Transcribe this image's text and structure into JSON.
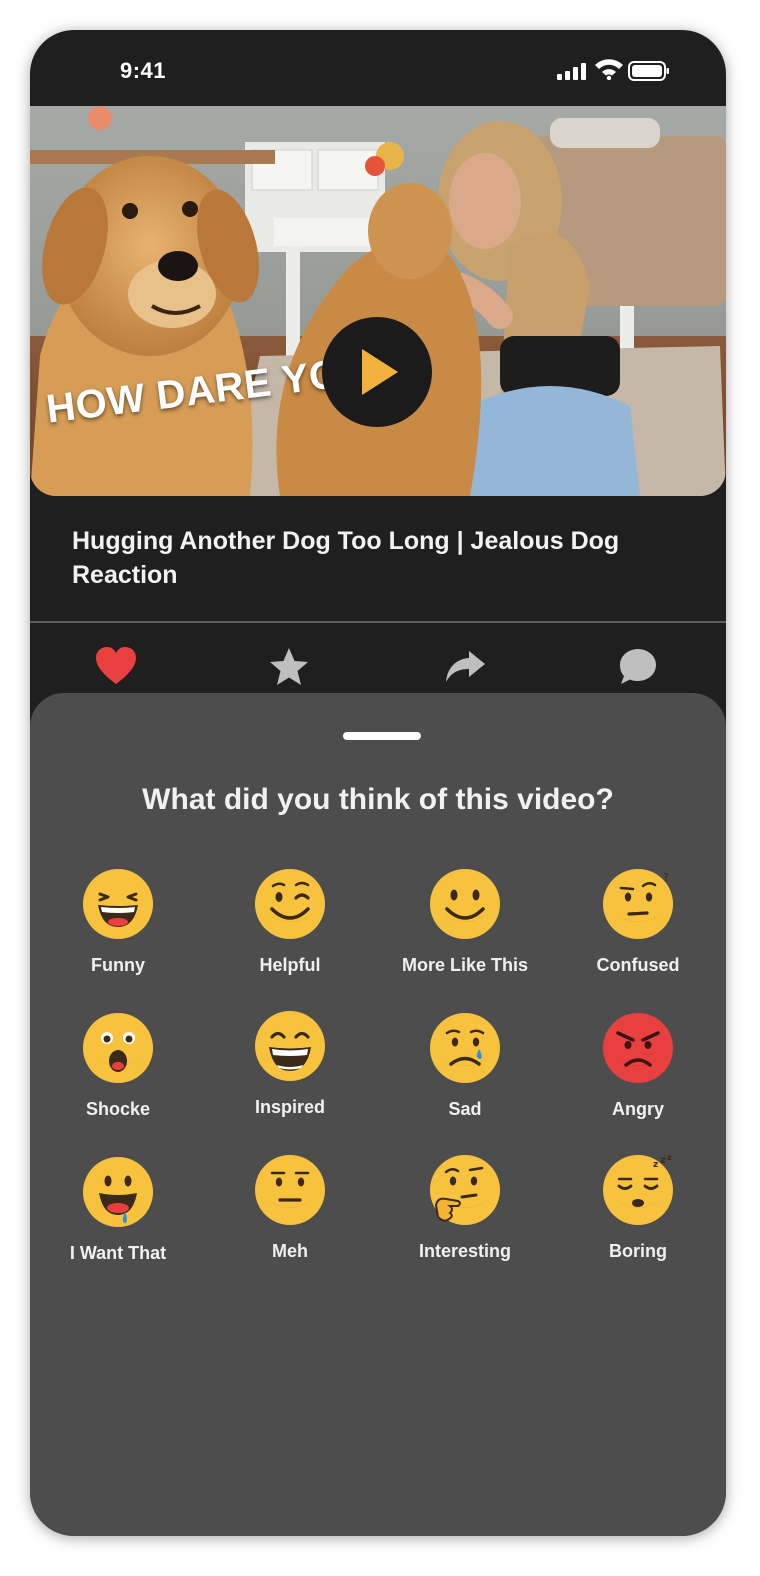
{
  "status_bar": {
    "time": "9:41"
  },
  "video": {
    "overlay_text": "HOW DARE YOU",
    "title": "Hugging Another Dog Too Long | Jealous Dog Reaction"
  },
  "actions": [
    {
      "icon": "heart-icon",
      "color": "#e8403f"
    },
    {
      "icon": "star-icon",
      "color": "#bfbfbf"
    },
    {
      "icon": "share-icon",
      "color": "#bfbfbf"
    },
    {
      "icon": "comment-icon",
      "color": "#bfbfbf"
    }
  ],
  "sheet": {
    "title": "What did you think of this video?",
    "reactions": [
      {
        "label": "Funny",
        "icon": "laughing-face-icon"
      },
      {
        "label": "Helpful",
        "icon": "winking-face-icon"
      },
      {
        "label": "More Like This",
        "icon": "smiling-face-icon"
      },
      {
        "label": "Confused",
        "icon": "confused-face-icon"
      },
      {
        "label": "Shocke",
        "icon": "shocked-face-icon"
      },
      {
        "label": "Inspired",
        "icon": "grinning-face-icon"
      },
      {
        "label": "Sad",
        "icon": "crying-face-icon"
      },
      {
        "label": "Angry",
        "icon": "angry-face-icon"
      },
      {
        "label": "I Want That",
        "icon": "drooling-face-icon"
      },
      {
        "label": "Meh",
        "icon": "neutral-face-icon"
      },
      {
        "label": "Interesting",
        "icon": "thinking-face-icon"
      },
      {
        "label": "Boring",
        "icon": "sleeping-face-icon"
      }
    ]
  },
  "colors": {
    "background": "#1f1f1f",
    "sheet": "#4d4d4d",
    "emoji_yellow": "#f7c23e",
    "angry_red": "#e8403f",
    "play_arrow": "#f3b23e"
  }
}
